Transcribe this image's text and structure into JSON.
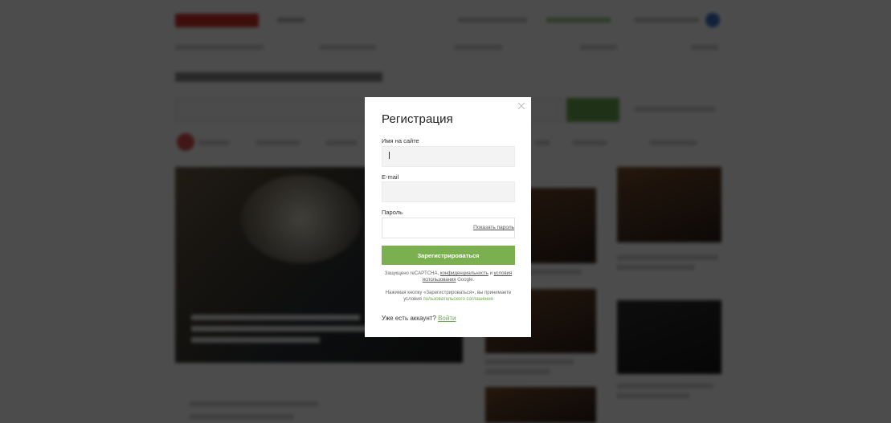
{
  "modal": {
    "title": "Регистрация",
    "name_label": "Имя на сайте",
    "name_value": "",
    "email_label": "E-mail",
    "email_value": "",
    "password_label": "Пароль",
    "password_value": "",
    "show_password": "Показать пароль",
    "submit_label": "Зарегистрироваться",
    "captcha_prefix": "Защищено reCAPTCHA, ",
    "captcha_privacy": "конфиденциальность",
    "captcha_and": " и ",
    "captcha_terms": "условия использования",
    "captcha_suffix": " Google.",
    "agreement_prefix": "Нажимая кнопку «Зарегистрироваться», вы принимаете условия ",
    "agreement_link": "пользовательского соглашения",
    "have_account": "Уже есть аккаунт?",
    "login_link": "Войти",
    "close_icon": "close-icon"
  },
  "colors": {
    "accent_green": "#7ab04f",
    "link_green": "#6aa84f",
    "brand_red": "#d0312d",
    "overlay": "rgba(0,0,0,0.70)"
  }
}
